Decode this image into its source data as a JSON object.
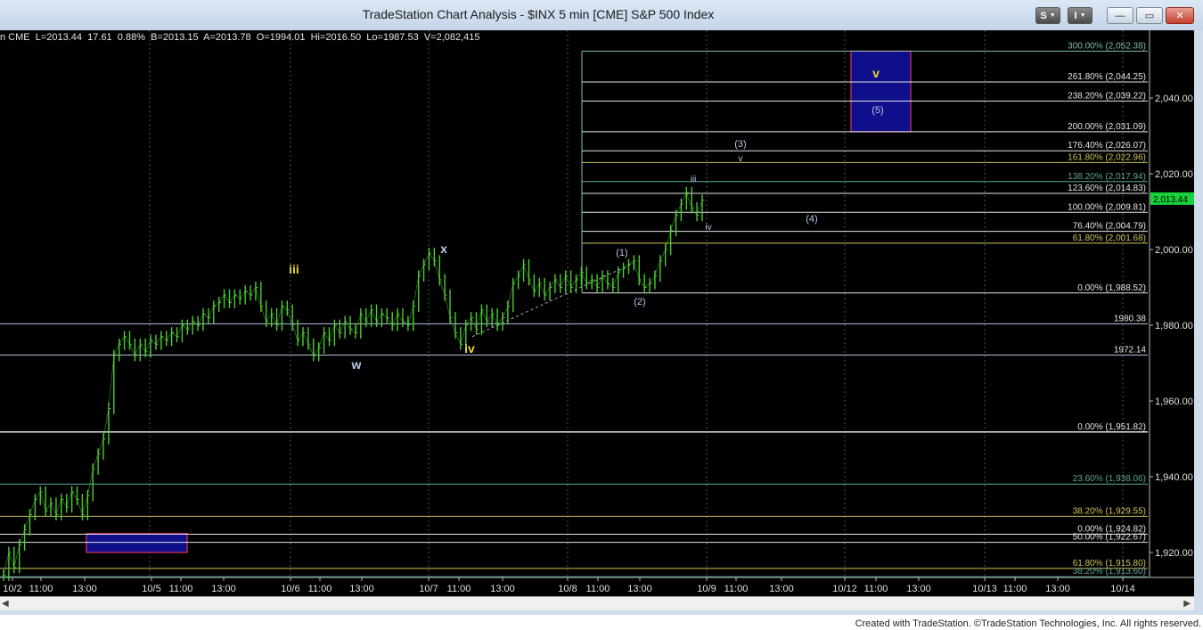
{
  "window": {
    "title": "TradeStation Chart Analysis - $INX 5 min [CME] S&P 500 Index",
    "buttons": {
      "s_menu": "S",
      "i_menu": "I",
      "minimize": "—",
      "restore": "▭",
      "close": "✕"
    }
  },
  "quote_bar": "n CME  L=2013.44  17.61  0.88%  B=2013.15  A=2013.78  O=1994.01  Hi=2016.50  Lo=1987.53  V=2,082,415",
  "price_tag": "2,013.44",
  "footer": "Created with TradeStation. ©TradeStation Technologies, Inc. All rights reserved.",
  "colors": {
    "background": "#000000",
    "price_bars": "#4ccd31",
    "price_tag": "#18d23c",
    "yellow_label": "#e8d434",
    "wave_label": "#b4c8e8",
    "target_box": "#0f0f8c",
    "target_box_border": "#e0306a"
  },
  "chart_data": {
    "type": "line",
    "title": "",
    "ylim": [
      1912,
      2056
    ],
    "y_ticks": [
      "1,920.00",
      "1,940.00",
      "1,960.00",
      "1,980.00",
      "2,000.00",
      "2,020.00",
      "2,040.00"
    ],
    "x_ticks": [
      "10/2",
      "11:00",
      "13:00",
      "10/5",
      "11:00",
      "13:00",
      "10/6",
      "11:00",
      "13:00",
      "10/7",
      "11:00",
      "13:00",
      "10/8",
      "11:00",
      "13:00",
      "10/9",
      "11:00",
      "13:00",
      "10/12",
      "11:00",
      "13:00",
      "10/13",
      "11:00",
      "13:00",
      "10/14"
    ],
    "last_price": 2013.44,
    "series": [
      {
        "values": [
          1914,
          1920,
          1916,
          1922,
          1926,
          1930,
          1934,
          1936,
          1931,
          1933,
          1930,
          1934,
          1932,
          1936,
          1934,
          1930,
          1935,
          1942,
          1946,
          1950,
          1958,
          1972,
          1975,
          1977,
          1975,
          1972,
          1975,
          1973,
          1976,
          1975,
          1977,
          1976,
          1978,
          1977,
          1980,
          1979,
          1981,
          1980,
          1983,
          1982,
          1985,
          1986,
          1988,
          1986,
          1988,
          1987,
          1989,
          1988,
          1990,
          1985,
          1981,
          1983,
          1980,
          1985,
          1984,
          1980,
          1976,
          1978,
          1975,
          1972,
          1974,
          1978,
          1976,
          1980,
          1978,
          1981,
          1979,
          1978,
          1983,
          1981,
          1984,
          1981,
          1983,
          1982,
          1980,
          1983,
          1981,
          1980,
          1985,
          1993,
          1996,
          1999,
          1997,
          1992,
          1988,
          1982,
          1978,
          1975,
          1980,
          1982,
          1979,
          1984,
          1981,
          1983,
          1980,
          1982,
          1985,
          1991,
          1993,
          1996,
          1992,
          1989,
          1991,
          1988,
          1990,
          1992,
          1990,
          1993,
          1990,
          1992,
          1994,
          1991,
          1992,
          1990,
          1993,
          1991,
          1990,
          1994,
          1995,
          1996,
          1997,
          1992,
          1990,
          1991,
          1993,
          1997,
          2000,
          2005,
          2009,
          2012,
          2015,
          2011,
          2009,
          2013
        ]
      }
    ],
    "fib_levels_top": [
      {
        "label": "300.00% (2,052.38)",
        "value": 2052.38,
        "color": "#7fbfaa"
      },
      {
        "label": "261.80% (2,044.25)",
        "value": 2044.25,
        "color": "#e6e6e6"
      },
      {
        "label": "238.20% (2,039.22)",
        "value": 2039.22,
        "color": "#e6e6e6"
      },
      {
        "label": "200.00% (2,031.09)",
        "value": 2031.09,
        "color": "#e6e6e6"
      },
      {
        "label": "176.40% (2,026.07)",
        "value": 2026.07,
        "color": "#e6e6e6"
      },
      {
        "label": "161.80% (2,022.96)",
        "value": 2022.96,
        "color": "#cfc35a"
      },
      {
        "label": "138.20% (2,017.94)",
        "value": 2017.94,
        "color": "#5fa79a"
      },
      {
        "label": "123.60% (2,014.83)",
        "value": 2014.83,
        "color": "#e6e6e6"
      },
      {
        "label": "100.00% (2,009.81)",
        "value": 2009.81,
        "color": "#e6e6e6"
      },
      {
        "label": "76.40% (2,004.79)",
        "value": 2004.79,
        "color": "#e6e6e6"
      },
      {
        "label": "61.80% (2,001.68)",
        "value": 2001.68,
        "color": "#cfc35a"
      },
      {
        "label": "0.00% (1,988.52)",
        "value": 1988.52,
        "color": "#e6e6e6"
      }
    ],
    "fib_levels_bottom": [
      {
        "label": "0.00% (1,951.82)",
        "value": 1951.82,
        "color": "#e6e6e6"
      },
      {
        "label": "23.60% (1,938.06)",
        "value": 1938.06,
        "color": "#5fa79a"
      },
      {
        "label": "38.20% (1,929.55)",
        "value": 1929.55,
        "color": "#cfc35a"
      },
      {
        "label": "0.00% (1,924.82)",
        "value": 1924.82,
        "color": "#e6e6e6"
      },
      {
        "label": "50.00% (1,922.67)",
        "value": 1922.67,
        "color": "#e6e6e6"
      },
      {
        "label": "61.80% (1,915.80)",
        "value": 1915.8,
        "color": "#cfc35a"
      },
      {
        "label": "38.20% (1,913.60)",
        "value": 1913.6,
        "color": "#5fa79a"
      }
    ],
    "support_levels": [
      {
        "label": "1980.38",
        "value": 1980.38
      },
      {
        "label": "1972.14",
        "value": 1972.14
      }
    ],
    "target_boxes": [
      {
        "name": "upper-target",
        "low": 2031.09,
        "high": 2052.38,
        "labels": [
          "v",
          "(5)"
        ]
      },
      {
        "name": "lower-support",
        "low": 1920.0,
        "high": 1925.0,
        "labels": []
      }
    ],
    "wave_labels": [
      {
        "text": "iii",
        "color": "yellow"
      },
      {
        "text": "w",
        "color": "blue"
      },
      {
        "text": "x",
        "color": "blue"
      },
      {
        "text": "iv",
        "color": "yellow"
      },
      {
        "text": "(1)",
        "color": "blue"
      },
      {
        "text": "(2)",
        "color": "blue"
      },
      {
        "text": "iii",
        "color": "blue"
      },
      {
        "text": "iv",
        "color": "blue"
      },
      {
        "text": "(3)",
        "color": "blue"
      },
      {
        "text": "v",
        "color": "blue"
      },
      {
        "text": "(4)",
        "color": "blue"
      },
      {
        "text": "v",
        "color": "yellow"
      },
      {
        "text": "(5)",
        "color": "blue"
      }
    ]
  }
}
